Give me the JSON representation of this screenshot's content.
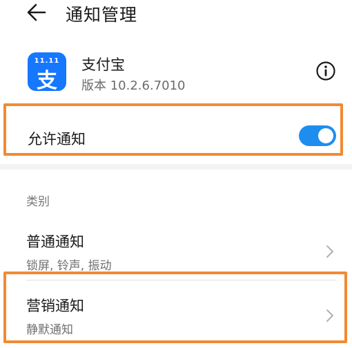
{
  "header": {
    "title": "通知管理",
    "back_icon": "arrow-left-icon"
  },
  "app": {
    "name": "支付宝",
    "version": "版本 10.2.6.7010",
    "icon_badge": "11.11",
    "icon_glyph": "支",
    "icon_color": "#1677ff",
    "info_icon": "info-icon"
  },
  "allow_notifications": {
    "label": "允许通知",
    "enabled": true,
    "toggle_color": "#1d8ef0"
  },
  "category_section": {
    "label": "类别"
  },
  "categories": [
    {
      "title": "普通通知",
      "subtitle": "锁屏, 铃声, 振动"
    },
    {
      "title": "营销通知",
      "subtitle": "静默通知"
    }
  ],
  "annotation": {
    "highlight_color": "#f28a32"
  }
}
